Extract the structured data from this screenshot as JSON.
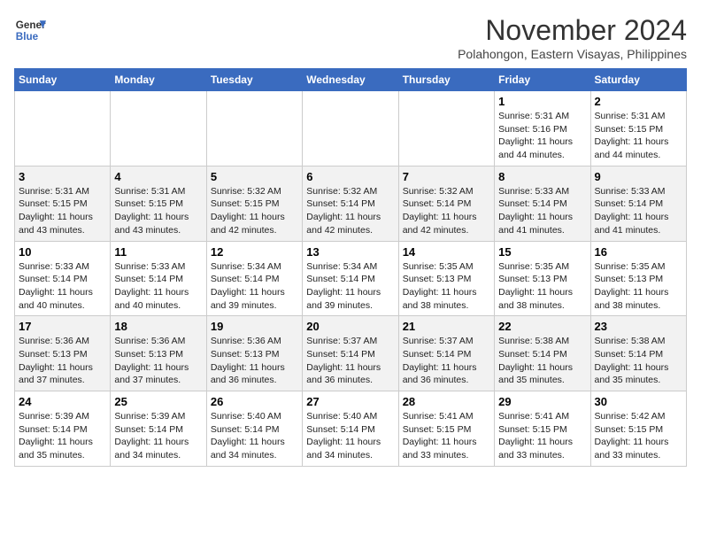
{
  "header": {
    "logo_line1": "General",
    "logo_line2": "Blue",
    "month": "November 2024",
    "location": "Polahongon, Eastern Visayas, Philippines"
  },
  "days_of_week": [
    "Sunday",
    "Monday",
    "Tuesday",
    "Wednesday",
    "Thursday",
    "Friday",
    "Saturday"
  ],
  "weeks": [
    {
      "row_class": "row-white",
      "days": [
        {
          "num": "",
          "info": ""
        },
        {
          "num": "",
          "info": ""
        },
        {
          "num": "",
          "info": ""
        },
        {
          "num": "",
          "info": ""
        },
        {
          "num": "",
          "info": ""
        },
        {
          "num": "1",
          "info": "Sunrise: 5:31 AM\nSunset: 5:16 PM\nDaylight: 11 hours\nand 44 minutes."
        },
        {
          "num": "2",
          "info": "Sunrise: 5:31 AM\nSunset: 5:15 PM\nDaylight: 11 hours\nand 44 minutes."
        }
      ]
    },
    {
      "row_class": "row-gray",
      "days": [
        {
          "num": "3",
          "info": "Sunrise: 5:31 AM\nSunset: 5:15 PM\nDaylight: 11 hours\nand 43 minutes."
        },
        {
          "num": "4",
          "info": "Sunrise: 5:31 AM\nSunset: 5:15 PM\nDaylight: 11 hours\nand 43 minutes."
        },
        {
          "num": "5",
          "info": "Sunrise: 5:32 AM\nSunset: 5:15 PM\nDaylight: 11 hours\nand 42 minutes."
        },
        {
          "num": "6",
          "info": "Sunrise: 5:32 AM\nSunset: 5:14 PM\nDaylight: 11 hours\nand 42 minutes."
        },
        {
          "num": "7",
          "info": "Sunrise: 5:32 AM\nSunset: 5:14 PM\nDaylight: 11 hours\nand 42 minutes."
        },
        {
          "num": "8",
          "info": "Sunrise: 5:33 AM\nSunset: 5:14 PM\nDaylight: 11 hours\nand 41 minutes."
        },
        {
          "num": "9",
          "info": "Sunrise: 5:33 AM\nSunset: 5:14 PM\nDaylight: 11 hours\nand 41 minutes."
        }
      ]
    },
    {
      "row_class": "row-white",
      "days": [
        {
          "num": "10",
          "info": "Sunrise: 5:33 AM\nSunset: 5:14 PM\nDaylight: 11 hours\nand 40 minutes."
        },
        {
          "num": "11",
          "info": "Sunrise: 5:33 AM\nSunset: 5:14 PM\nDaylight: 11 hours\nand 40 minutes."
        },
        {
          "num": "12",
          "info": "Sunrise: 5:34 AM\nSunset: 5:14 PM\nDaylight: 11 hours\nand 39 minutes."
        },
        {
          "num": "13",
          "info": "Sunrise: 5:34 AM\nSunset: 5:14 PM\nDaylight: 11 hours\nand 39 minutes."
        },
        {
          "num": "14",
          "info": "Sunrise: 5:35 AM\nSunset: 5:13 PM\nDaylight: 11 hours\nand 38 minutes."
        },
        {
          "num": "15",
          "info": "Sunrise: 5:35 AM\nSunset: 5:13 PM\nDaylight: 11 hours\nand 38 minutes."
        },
        {
          "num": "16",
          "info": "Sunrise: 5:35 AM\nSunset: 5:13 PM\nDaylight: 11 hours\nand 38 minutes."
        }
      ]
    },
    {
      "row_class": "row-gray",
      "days": [
        {
          "num": "17",
          "info": "Sunrise: 5:36 AM\nSunset: 5:13 PM\nDaylight: 11 hours\nand 37 minutes."
        },
        {
          "num": "18",
          "info": "Sunrise: 5:36 AM\nSunset: 5:13 PM\nDaylight: 11 hours\nand 37 minutes."
        },
        {
          "num": "19",
          "info": "Sunrise: 5:36 AM\nSunset: 5:13 PM\nDaylight: 11 hours\nand 36 minutes."
        },
        {
          "num": "20",
          "info": "Sunrise: 5:37 AM\nSunset: 5:14 PM\nDaylight: 11 hours\nand 36 minutes."
        },
        {
          "num": "21",
          "info": "Sunrise: 5:37 AM\nSunset: 5:14 PM\nDaylight: 11 hours\nand 36 minutes."
        },
        {
          "num": "22",
          "info": "Sunrise: 5:38 AM\nSunset: 5:14 PM\nDaylight: 11 hours\nand 35 minutes."
        },
        {
          "num": "23",
          "info": "Sunrise: 5:38 AM\nSunset: 5:14 PM\nDaylight: 11 hours\nand 35 minutes."
        }
      ]
    },
    {
      "row_class": "row-white",
      "days": [
        {
          "num": "24",
          "info": "Sunrise: 5:39 AM\nSunset: 5:14 PM\nDaylight: 11 hours\nand 35 minutes."
        },
        {
          "num": "25",
          "info": "Sunrise: 5:39 AM\nSunset: 5:14 PM\nDaylight: 11 hours\nand 34 minutes."
        },
        {
          "num": "26",
          "info": "Sunrise: 5:40 AM\nSunset: 5:14 PM\nDaylight: 11 hours\nand 34 minutes."
        },
        {
          "num": "27",
          "info": "Sunrise: 5:40 AM\nSunset: 5:14 PM\nDaylight: 11 hours\nand 34 minutes."
        },
        {
          "num": "28",
          "info": "Sunrise: 5:41 AM\nSunset: 5:15 PM\nDaylight: 11 hours\nand 33 minutes."
        },
        {
          "num": "29",
          "info": "Sunrise: 5:41 AM\nSunset: 5:15 PM\nDaylight: 11 hours\nand 33 minutes."
        },
        {
          "num": "30",
          "info": "Sunrise: 5:42 AM\nSunset: 5:15 PM\nDaylight: 11 hours\nand 33 minutes."
        }
      ]
    }
  ]
}
